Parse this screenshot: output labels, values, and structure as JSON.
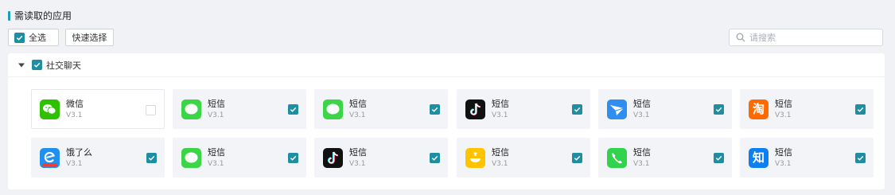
{
  "section": {
    "title": "需读取的应用"
  },
  "toolbar": {
    "select_all_label": "全选",
    "select_all_checked": true,
    "quick_select_label": "快速选择"
  },
  "search": {
    "placeholder": "请搜索",
    "value": ""
  },
  "group": {
    "name": "社交聊天",
    "expanded": true,
    "checked": true
  },
  "colors": {
    "accent": "#1f8ea0",
    "title_bar": "#1aa2b4"
  },
  "apps": [
    {
      "name": "微信",
      "version": "V3.1",
      "icon": "wechat-icon",
      "checked": false
    },
    {
      "name": "短信",
      "version": "V3.1",
      "icon": "messages-icon",
      "checked": true
    },
    {
      "name": "短信",
      "version": "V3.1",
      "icon": "messages-icon",
      "checked": true
    },
    {
      "name": "短信",
      "version": "V3.1",
      "icon": "tiktok-icon",
      "checked": true
    },
    {
      "name": "短信",
      "version": "V3.1",
      "icon": "paper-plane-icon",
      "checked": true
    },
    {
      "name": "短信",
      "version": "V3.1",
      "icon": "taobao-icon",
      "checked": true
    },
    {
      "name": "饿了么",
      "version": "V3.1",
      "icon": "eleme-icon",
      "checked": true
    },
    {
      "name": "短信",
      "version": "V3.1",
      "icon": "messages-icon",
      "checked": true
    },
    {
      "name": "短信",
      "version": "V3.1",
      "icon": "tiktok-icon",
      "checked": true
    },
    {
      "name": "短信",
      "version": "V3.1",
      "icon": "meituan-icon",
      "checked": true
    },
    {
      "name": "短信",
      "version": "V3.1",
      "icon": "phone-icon",
      "checked": true
    },
    {
      "name": "短信",
      "version": "V3.1",
      "icon": "zhihu-icon",
      "checked": true
    }
  ]
}
